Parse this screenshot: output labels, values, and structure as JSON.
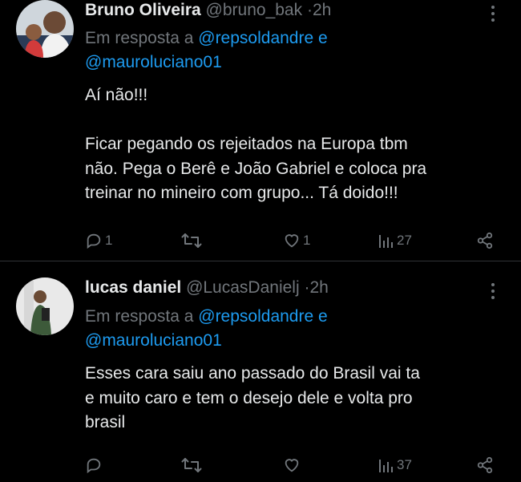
{
  "tweets": [
    {
      "name": "Bruno Oliveira",
      "handle": "@bruno_bak",
      "dot": "·",
      "time": "2h",
      "reply_prefix": "Em resposta a",
      "mention1": "@repsoldandre",
      "conj": "e",
      "mention2": "@mauroluciano01",
      "body": [
        "Aí não!!!",
        "",
        "Ficar pegando os rejeitados na Europa tbm",
        "não. Pega o Berê e João Gabriel e coloca pra",
        "treinar no mineiro com grupo... Tá doido!!!"
      ],
      "replies": "1",
      "retweets": "",
      "likes": "1",
      "views": "27"
    },
    {
      "name": "lucas daniel",
      "handle": "@LucasDanielj",
      "dot": "·",
      "time": "2h",
      "reply_prefix": "Em resposta a",
      "mention1": "@repsoldandre",
      "conj": "e",
      "mention2": "@mauroluciano01",
      "body": [
        "Esses cara saiu ano passado do Brasil vai ta",
        "e muito caro e tem o desejo dele e volta pro",
        "brasil"
      ],
      "replies": "",
      "retweets": "",
      "likes": "",
      "views": "37"
    }
  ],
  "icons": {
    "reply": "reply-icon",
    "retweet": "retweet-icon",
    "like": "heart-icon",
    "views": "views-icon",
    "share": "share-icon",
    "more": "more-icon"
  },
  "colors": {
    "background": "#000000",
    "text": "#e7e9ea",
    "muted": "#71767b",
    "link": "#1d9bf0",
    "divider": "#2f3336"
  }
}
